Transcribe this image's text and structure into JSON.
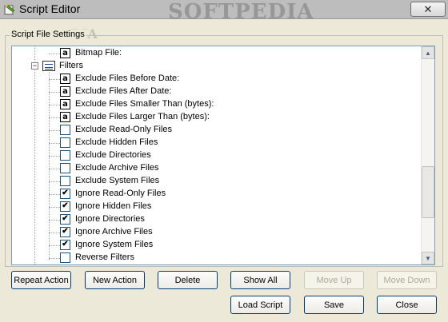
{
  "window": {
    "title": "Script Editor",
    "watermark": "SOFTPEDIA",
    "close_label": "✕"
  },
  "group": {
    "label": "Script File Settings",
    "watermark": "DIA"
  },
  "tree": {
    "top_item": {
      "label": "Bitmap File:",
      "type": "text"
    },
    "filters_node": {
      "label": "Filters",
      "expander": "−"
    },
    "items": [
      {
        "label": "Exclude Files Before Date:",
        "type": "text"
      },
      {
        "label": "Exclude Files After Date:",
        "type": "text"
      },
      {
        "label": "Exclude Files Smaller Than (bytes):",
        "type": "text"
      },
      {
        "label": "Exclude Files Larger Than (bytes):",
        "type": "text"
      },
      {
        "label": "Exclude Read-Only Files",
        "type": "checkbox",
        "checked": false
      },
      {
        "label": "Exclude Hidden Files",
        "type": "checkbox",
        "checked": false
      },
      {
        "label": "Exclude Directories",
        "type": "checkbox",
        "checked": false
      },
      {
        "label": "Exclude Archive Files",
        "type": "checkbox",
        "checked": false
      },
      {
        "label": "Exclude System Files",
        "type": "checkbox",
        "checked": false
      },
      {
        "label": "Ignore Read-Only Files",
        "type": "checkbox",
        "checked": true
      },
      {
        "label": "Ignore Hidden Files",
        "type": "checkbox",
        "checked": true
      },
      {
        "label": "Ignore Directories",
        "type": "checkbox",
        "checked": true
      },
      {
        "label": "Ignore Archive Files",
        "type": "checkbox",
        "checked": true
      },
      {
        "label": "Ignore System Files",
        "type": "checkbox",
        "checked": true
      },
      {
        "label": "Reverse Filters",
        "type": "checkbox",
        "checked": false
      }
    ],
    "text_icon_glyph": "a",
    "scroll_up_glyph": "▲",
    "scroll_down_glyph": "▼"
  },
  "buttons": {
    "repeat_action": "Repeat Action",
    "new_action": "New Action",
    "delete": "Delete",
    "show_all": "Show All",
    "move_up": "Move Up",
    "move_down": "Move Down",
    "load_script": "Load Script",
    "save": "Save",
    "close": "Close"
  }
}
